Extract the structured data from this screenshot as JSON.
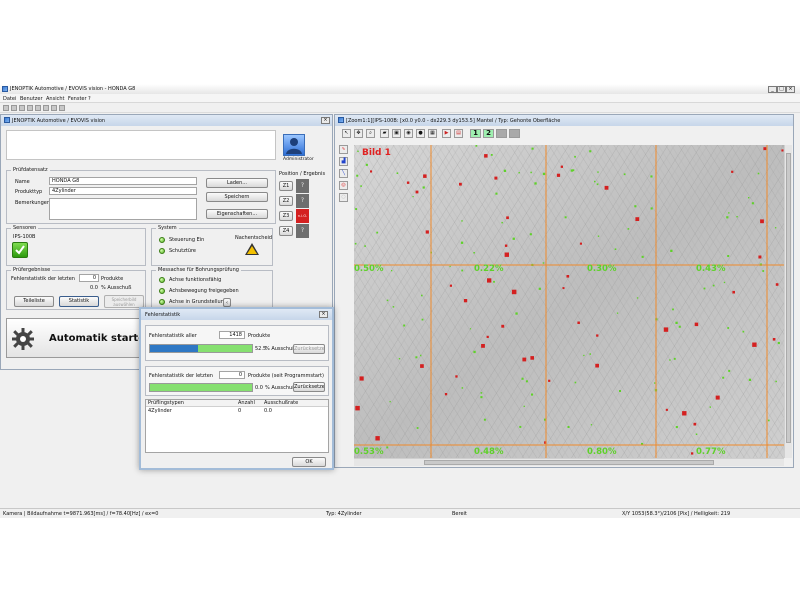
{
  "main_window": {
    "title": "JENOPTIK Automotive / EVOVIS vision - HONDA G8",
    "menu": [
      "Datei",
      "Benutzer",
      "Ansicht",
      "Fenster",
      "?"
    ]
  },
  "left_panel": {
    "title": "JENOPTIK Automotive / EVOVIS vision",
    "user_role": "Administrator",
    "pruefdatensatz": {
      "title": "Prüfdatensatz",
      "name_label": "Name",
      "name_value": "HONDA G8",
      "produkttyp_label": "Produkttyp",
      "produkttyp_value": "4Zylinder",
      "bemerkungen_label": "Bemerkungen",
      "btn_laden": "Laden...",
      "btn_speichern": "Speichern",
      "btn_eigenschaften": "Eigenschaften..."
    },
    "position": {
      "title": "Position / Ergebnis",
      "rows": [
        {
          "label": "Z1",
          "result": "?"
        },
        {
          "label": "Z2",
          "result": "?"
        },
        {
          "label": "Z3",
          "result": "n.i.O."
        },
        {
          "label": "Z4",
          "result": "?"
        }
      ]
    },
    "sensoren": {
      "title": "Sensoren",
      "value": "IPS-100B"
    },
    "system": {
      "title": "System",
      "items": [
        "Steuerung Ein",
        "Schutztüre"
      ],
      "nachentscheid": "Nachentscheid"
    },
    "pruefergebnisse": {
      "title": "Prüfergebnisse",
      "fehlerstatistik_label": "Fehlerstatistik der letzten",
      "count": "0",
      "produkte_label": "Produkte",
      "ausschuss_value": "0.0",
      "ausschuss_label": "% Ausschuß",
      "btn_teileliste": "Teileliste",
      "btn_statistik": "Statistik",
      "btn_speicherbild_line1": "Speicherbild",
      "btn_speicherbild_line2": "auswählen"
    },
    "messachse": {
      "title": "Messachse für Bohrungsprüfung",
      "items": [
        "Achse funktionsfähig",
        "Achsbewegung freigegeben",
        "Achse in Grundstellung"
      ]
    },
    "automatik_label": "Automatik starten"
  },
  "image_window": {
    "title": "[Zoom1:1][IPS-100B: [x0.0 y0.0 - dx229.3 dy153.5] Mantel / Typ: Gehonte Oberfläche",
    "toolbar_num1": "1",
    "toolbar_num2": "2",
    "image_label": "Bild 1",
    "grid_values": [
      {
        "row": 1,
        "col": 1,
        "value": "0.50%"
      },
      {
        "row": 1,
        "col": 2,
        "value": "0.22%"
      },
      {
        "row": 1,
        "col": 3,
        "value": "0.30%"
      },
      {
        "row": 1,
        "col": 4,
        "value": "0.43%"
      },
      {
        "row": 2,
        "col": 1,
        "value": "0.53%"
      },
      {
        "row": 2,
        "col": 2,
        "value": "0.48%"
      },
      {
        "row": 2,
        "col": 3,
        "value": "0.80%"
      },
      {
        "row": 2,
        "col": 4,
        "value": "0.77%"
      }
    ]
  },
  "dialog": {
    "title": "Fehlerstatistik",
    "section1_label": "Fehlerstatistik aller",
    "section1_count": "1418",
    "section1_unit": "Produkte",
    "section1_progress_good": 0.475,
    "section1_percent": "52.5",
    "section1_percent_label": "% Ausschuß",
    "section1_reset": "Zurücksetzen",
    "section2_label": "Fehlerstatistik der letzten",
    "section2_count": "0",
    "section2_unit": "Produkte (seit Programmstart)",
    "section2_percent": "0.0",
    "section2_percent_label": "% Ausschuß",
    "section2_reset": "Zurücksetzen",
    "table_headers": [
      "Prüflingstypen",
      "Anzahl",
      "Ausschußrate"
    ],
    "table_rows": [
      [
        "4Zylinder",
        "0",
        "0.0"
      ]
    ],
    "ok_label": "OK"
  },
  "statusbar": {
    "left": "Kamera | Bildaufnahme t=9871.963[ms] / f=78.40[Hz] / ex=0",
    "type": "Typ: 4Zylinder",
    "state": "Bereit",
    "right": "X/Y 1053(58.3°)/2106 [Pix] / Helligkeit: 219"
  },
  "colors": {
    "accent_green": "#5fd12a",
    "grid_orange": "#f08a2a",
    "reject_red": "#d42020",
    "progress_blue": "#2f78c4",
    "progress_green": "#86e070"
  }
}
